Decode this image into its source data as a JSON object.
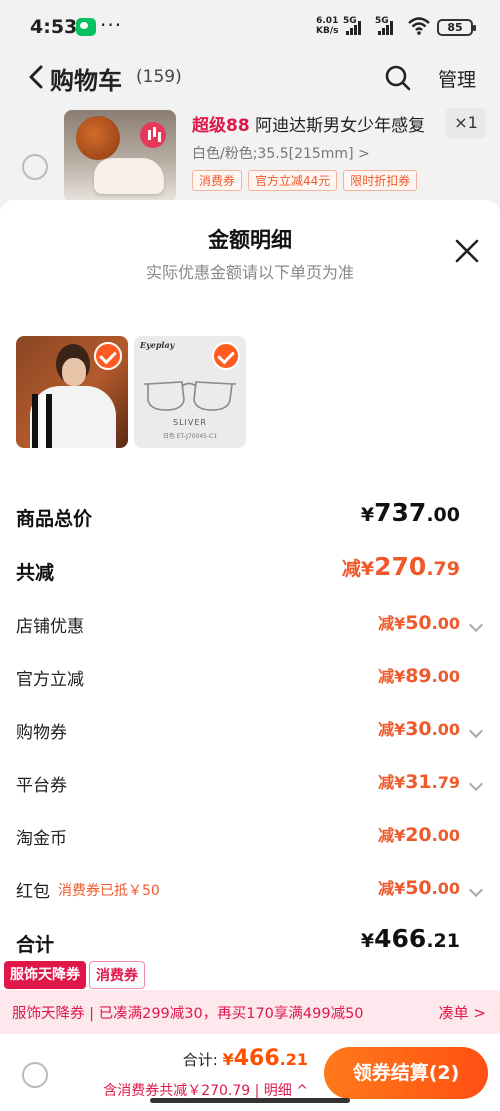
{
  "status_bar": {
    "time": "4:53",
    "speed_value": "6.01",
    "speed_unit": "KB/s",
    "signal_1": "5G",
    "signal_2": "5G",
    "battery": "85"
  },
  "nav": {
    "title": "购物车",
    "count": "(159)",
    "manage": "管理"
  },
  "cart_item": {
    "title_highlight": "超级88",
    "title": "阿迪达斯男女少年感复",
    "qty": "×1",
    "spec": "白色/粉色;35.5[215mm] >",
    "tags": [
      "消费券",
      "官方立减44元",
      "限时折扣券"
    ]
  },
  "sheet": {
    "title": "金额明细",
    "subtitle": "实际优惠金额请以下单页为准",
    "glasses_brand": "Eyeplay",
    "glasses_label": "SLIVER",
    "glasses_code": "日色 ET-J70045-C1",
    "rows": [
      {
        "label": "商品总价",
        "prefix": "¥",
        "int": "737",
        "dec": ".00"
      },
      {
        "label": "共减",
        "prefix": "减¥",
        "int": "270",
        "dec": ".79"
      },
      {
        "label": "店铺优惠",
        "prefix": "减¥",
        "int": "50",
        "dec": ".00"
      },
      {
        "label": "官方立减",
        "prefix": "减¥",
        "int": "89",
        "dec": ".00"
      },
      {
        "label": "购物券",
        "prefix": "减¥",
        "int": "30",
        "dec": ".00"
      },
      {
        "label": "平台券",
        "prefix": "减¥",
        "int": "31",
        "dec": ".79"
      },
      {
        "label": "淘金币",
        "prefix": "减¥",
        "int": "20",
        "dec": ".00"
      },
      {
        "label": "红包",
        "note": "消费券已抵￥50",
        "prefix": "减¥",
        "int": "50",
        "dec": ".00"
      },
      {
        "label": "合计",
        "prefix": "¥",
        "int": "466",
        "dec": ".21"
      }
    ]
  },
  "coupon_tabs": [
    "服饰天降券",
    "消费券"
  ],
  "promo": {
    "text": "服饰天降券 | 已凑满299减30，再买170享满499减50",
    "link": "凑单 >"
  },
  "footer": {
    "total_label": "合计:",
    "total_prefix": "¥",
    "total_int": "466",
    "total_dec": ".21",
    "detail": "含消费券共减￥270.79 | 明细 ^",
    "checkout": "领券结算(2)"
  },
  "colors": {
    "accent": "#ff5000",
    "discount": "#ef5a2c",
    "promo_red": "#e0184a"
  }
}
